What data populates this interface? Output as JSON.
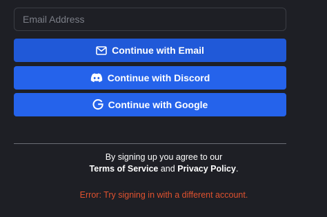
{
  "email": {
    "placeholder": "Email Address",
    "value": ""
  },
  "buttons": {
    "email": {
      "label": "Continue with Email",
      "icon": "mail-icon"
    },
    "discord": {
      "label": "Continue with Discord",
      "icon": "discord-icon"
    },
    "google": {
      "label": "Continue with Google",
      "icon": "google-icon"
    }
  },
  "legal": {
    "prefix": "By signing up you agree to our",
    "terms": "Terms of Service",
    "and": "and",
    "privacy": "Privacy Policy",
    "suffix": "."
  },
  "error": "Error: Try signing in with a different account.",
  "colors": {
    "background": "#1e1f25",
    "button": "#2563eb",
    "error": "#e0522f"
  }
}
